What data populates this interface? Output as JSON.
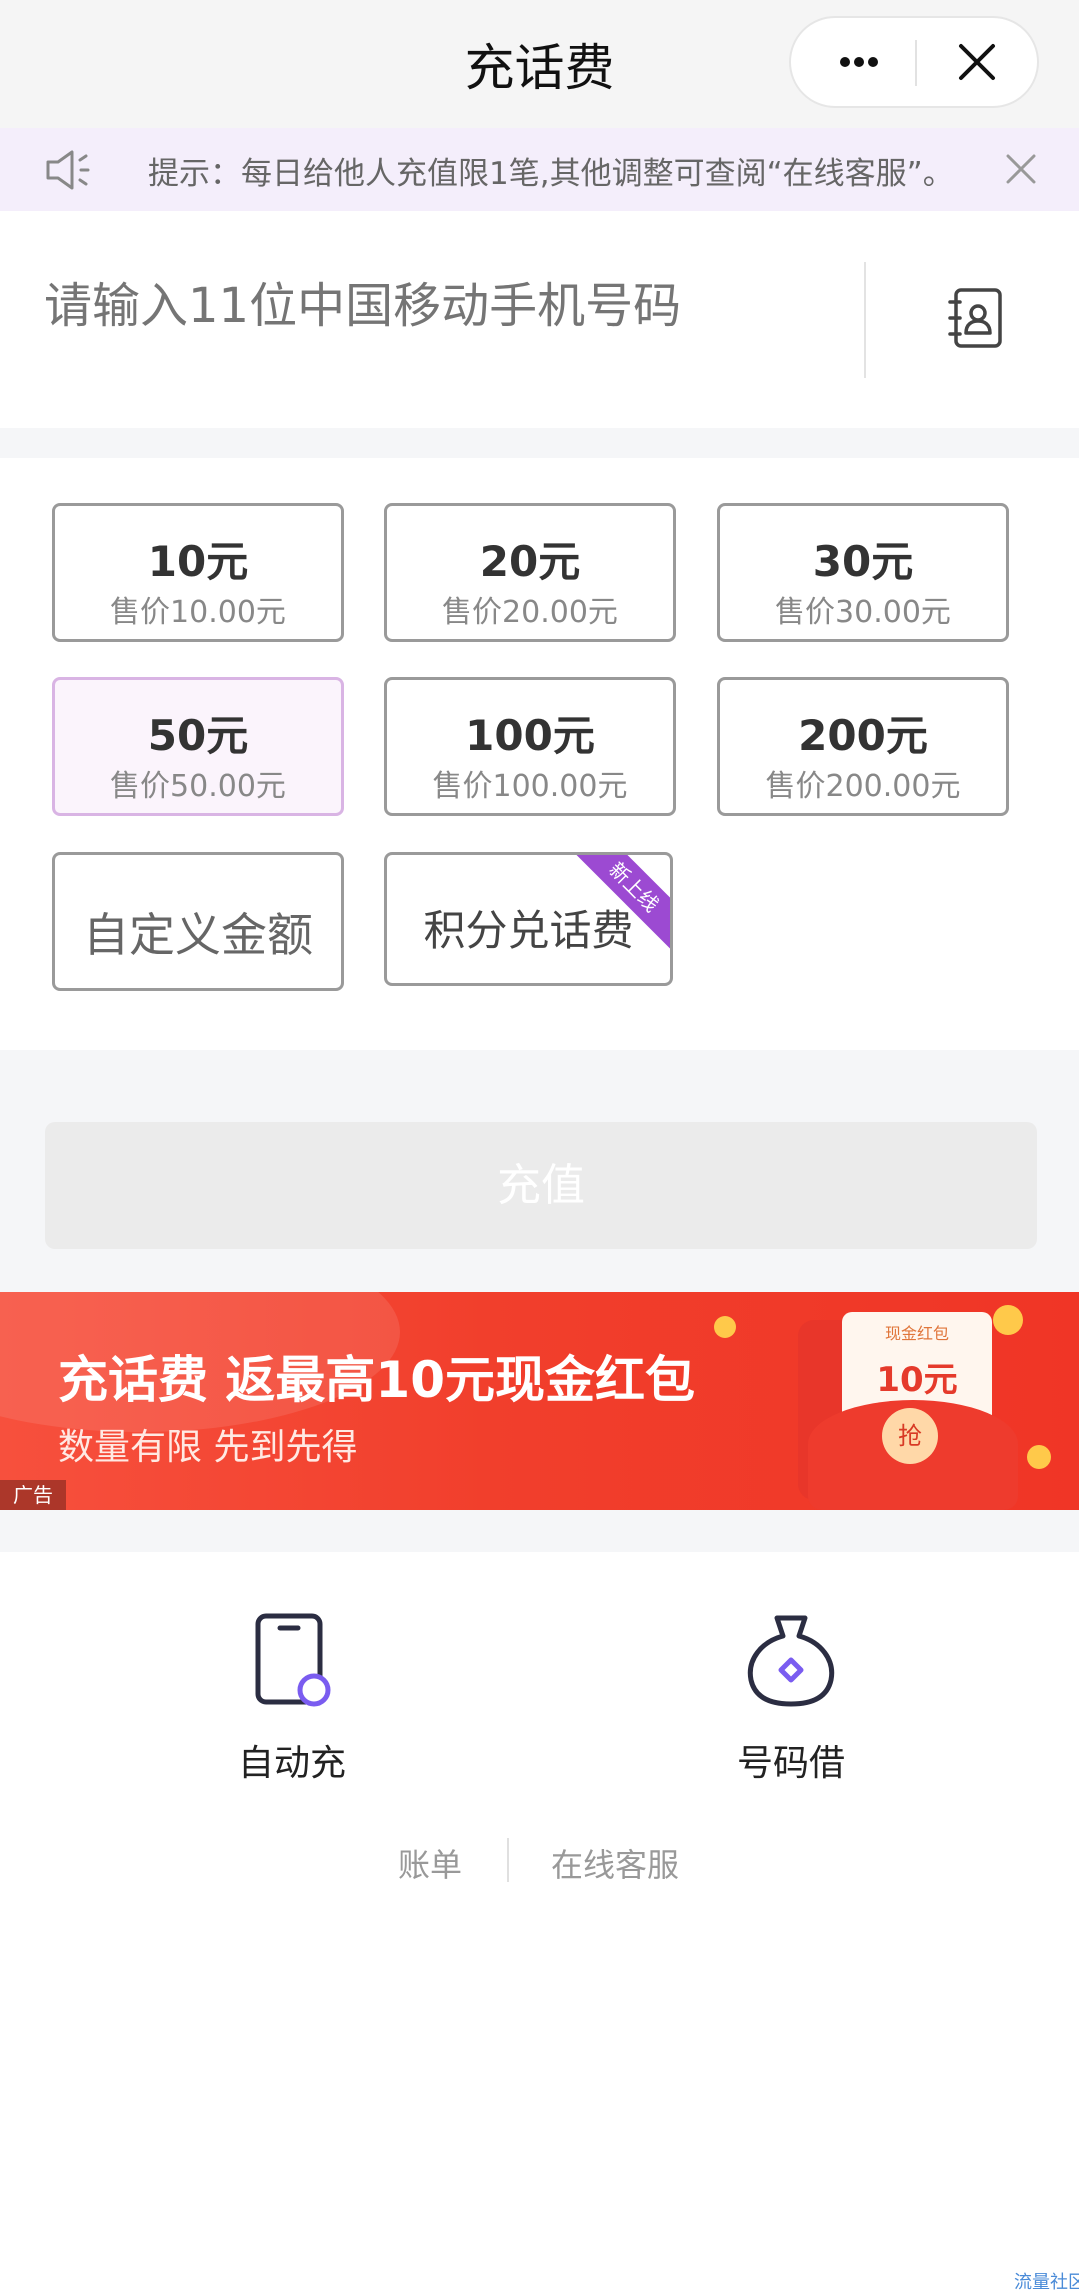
{
  "header": {
    "title": "充话费"
  },
  "notice": {
    "text": "提示：每日给他人充值限1笔,其他调整可查阅“在线客服”。"
  },
  "phone": {
    "placeholder": "请输入11位中国移动手机号码"
  },
  "amounts": [
    {
      "amount": "10元",
      "price": "售价10.00元"
    },
    {
      "amount": "20元",
      "price": "售价20.00元"
    },
    {
      "amount": "30元",
      "price": "售价30.00元"
    },
    {
      "amount": "50元",
      "price": "售价50.00元",
      "selected": true
    },
    {
      "amount": "100元",
      "price": "售价100.00元"
    },
    {
      "amount": "200元",
      "price": "售价200.00元"
    }
  ],
  "custom_amount": "自定义金额",
  "points_exchange": {
    "label": "积分兑话费",
    "badge": "新上线"
  },
  "recharge_button": "充值",
  "banner": {
    "headline": "充话费 返最高10元现金红包",
    "subline": "数量有限 先到先得",
    "ad_tag": "广告",
    "envelope_label": "现金红包",
    "envelope_amount": "10元",
    "grab": "抢"
  },
  "features": [
    {
      "label": "自动充",
      "icon": "phone-auto-icon"
    },
    {
      "label": "号码借",
      "icon": "money-bag-icon"
    }
  ],
  "links": {
    "bill": "账单",
    "service": "在线客服"
  },
  "watermark": "流量社区",
  "colors": {
    "accent": "#9c4ad2",
    "banner": "#f13f2c",
    "notice_bg": "#f4eefb"
  }
}
